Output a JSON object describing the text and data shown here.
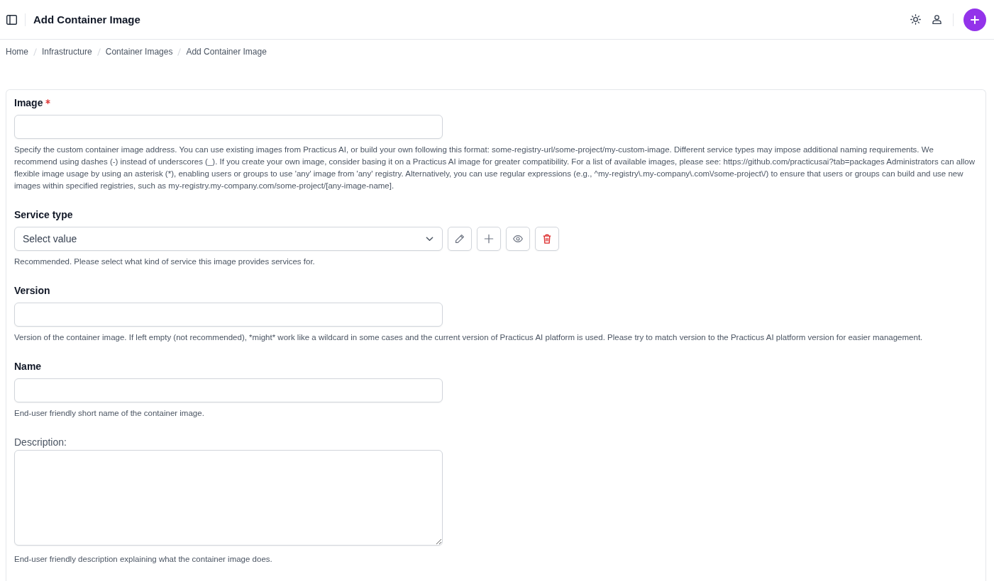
{
  "header": {
    "title": "Add Container Image"
  },
  "breadcrumb": [
    {
      "label": "Home"
    },
    {
      "label": "Infrastructure"
    },
    {
      "label": "Container Images"
    },
    {
      "label": "Add Container Image"
    }
  ],
  "form": {
    "fields": [
      {
        "kind": "text",
        "label": "Image",
        "required": true,
        "help": "Specify the custom container image address. You can use existing images from Practicus AI, or build your own following this format: some-registry-url/some-project/my-custom-image. Different service types may impose additional naming requirements. We recommend using dashes (-) instead of underscores (_). If you create your own image, consider basing it on a Practicus AI image for greater compatibility. For a list of available images, please see: https://github.com/practicusai?tab=packages Administrators can allow flexible image usage by using an asterisk (*), enabling users or groups to use 'any' image from 'any' registry. Alternatively, you can use regular expressions (e.g., ^my-registry\\.my-company\\.com\\/some-project\\/) to ensure that users or groups can build and use new images within specified registries, such as my-registry.my-company.com/some-project/[any-image-name]."
      },
      {
        "kind": "select",
        "label": "Service type",
        "required": false,
        "placeholder": "Select value",
        "actions": [
          {
            "kind": "edit"
          },
          {
            "kind": "add"
          },
          {
            "kind": "view"
          },
          {
            "kind": "delete"
          }
        ],
        "help": "Recommended. Please select what kind of service this image provides services for."
      },
      {
        "kind": "text",
        "label": "Version",
        "required": false,
        "help": "Version of the container image. If left empty (not recommended), *might* work like a wildcard in some cases and the current version of Practicus AI platform is used. Please try to match version to the Practicus AI platform version for easier management."
      },
      {
        "kind": "text",
        "label": "Name",
        "required": false,
        "help": "End-user friendly short name of the container image."
      },
      {
        "kind": "textarea",
        "label": "Description:",
        "required": false,
        "help": "End-user friendly description explaining what the container image does."
      }
    ]
  }
}
